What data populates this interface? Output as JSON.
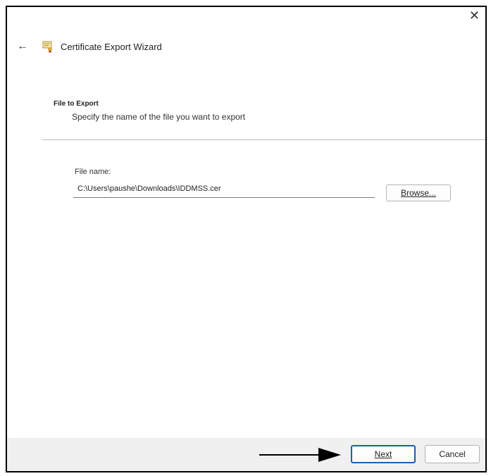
{
  "window": {
    "title": "Certificate Export Wizard",
    "close_glyph": "✕",
    "back_glyph": "←"
  },
  "section": {
    "title": "File to Export",
    "subtitle": "Specify the name of the file you want to export"
  },
  "file": {
    "label": "File name:",
    "value": "C:\\Users\\paushe\\Downloads\\IDDMSS.cer",
    "browse_label": "Browse..."
  },
  "footer": {
    "next_label": "Next",
    "cancel_label": "Cancel"
  },
  "icons": [
    "back-arrow-icon",
    "certificate-icon",
    "close-icon",
    "callout-arrow-icon"
  ],
  "colors": {
    "accent": "#1f5fa8",
    "footer_bg": "#f0f0f0"
  }
}
